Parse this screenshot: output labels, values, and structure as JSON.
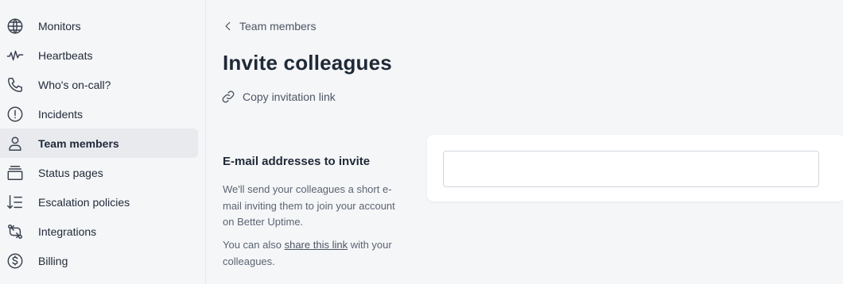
{
  "sidebar": {
    "items": [
      {
        "label": "Monitors",
        "icon": "globe-icon"
      },
      {
        "label": "Heartbeats",
        "icon": "heartbeat-icon"
      },
      {
        "label": "Who's on-call?",
        "icon": "phone-icon"
      },
      {
        "label": "Incidents",
        "icon": "alert-circle-icon"
      },
      {
        "label": "Team members",
        "icon": "user-icon",
        "active": true
      },
      {
        "label": "Status pages",
        "icon": "layers-icon"
      },
      {
        "label": "Escalation policies",
        "icon": "sort-list-icon"
      },
      {
        "label": "Integrations",
        "icon": "arrows-exchange-icon"
      },
      {
        "label": "Billing",
        "icon": "dollar-circle-icon"
      }
    ]
  },
  "breadcrumb": {
    "label": "Team members",
    "icon": "chevron-left-icon"
  },
  "page": {
    "title": "Invite colleagues"
  },
  "copy_link": {
    "label": "Copy invitation link",
    "icon": "link-icon"
  },
  "invite_section": {
    "title": "E-mail addresses to invite",
    "description": "We'll send your colleagues a short e-mail inviting them to join your account on Better Uptime.",
    "share_prefix": "You can also ",
    "share_link_label": "share this link",
    "share_suffix": " with your colleagues."
  },
  "email_input": {
    "value": "",
    "placeholder": ""
  },
  "colors": {
    "sidebar_bg": "#f5f6f8",
    "active_item_bg": "#e8eaee",
    "text": "#1f2937",
    "muted": "#5b6472"
  }
}
